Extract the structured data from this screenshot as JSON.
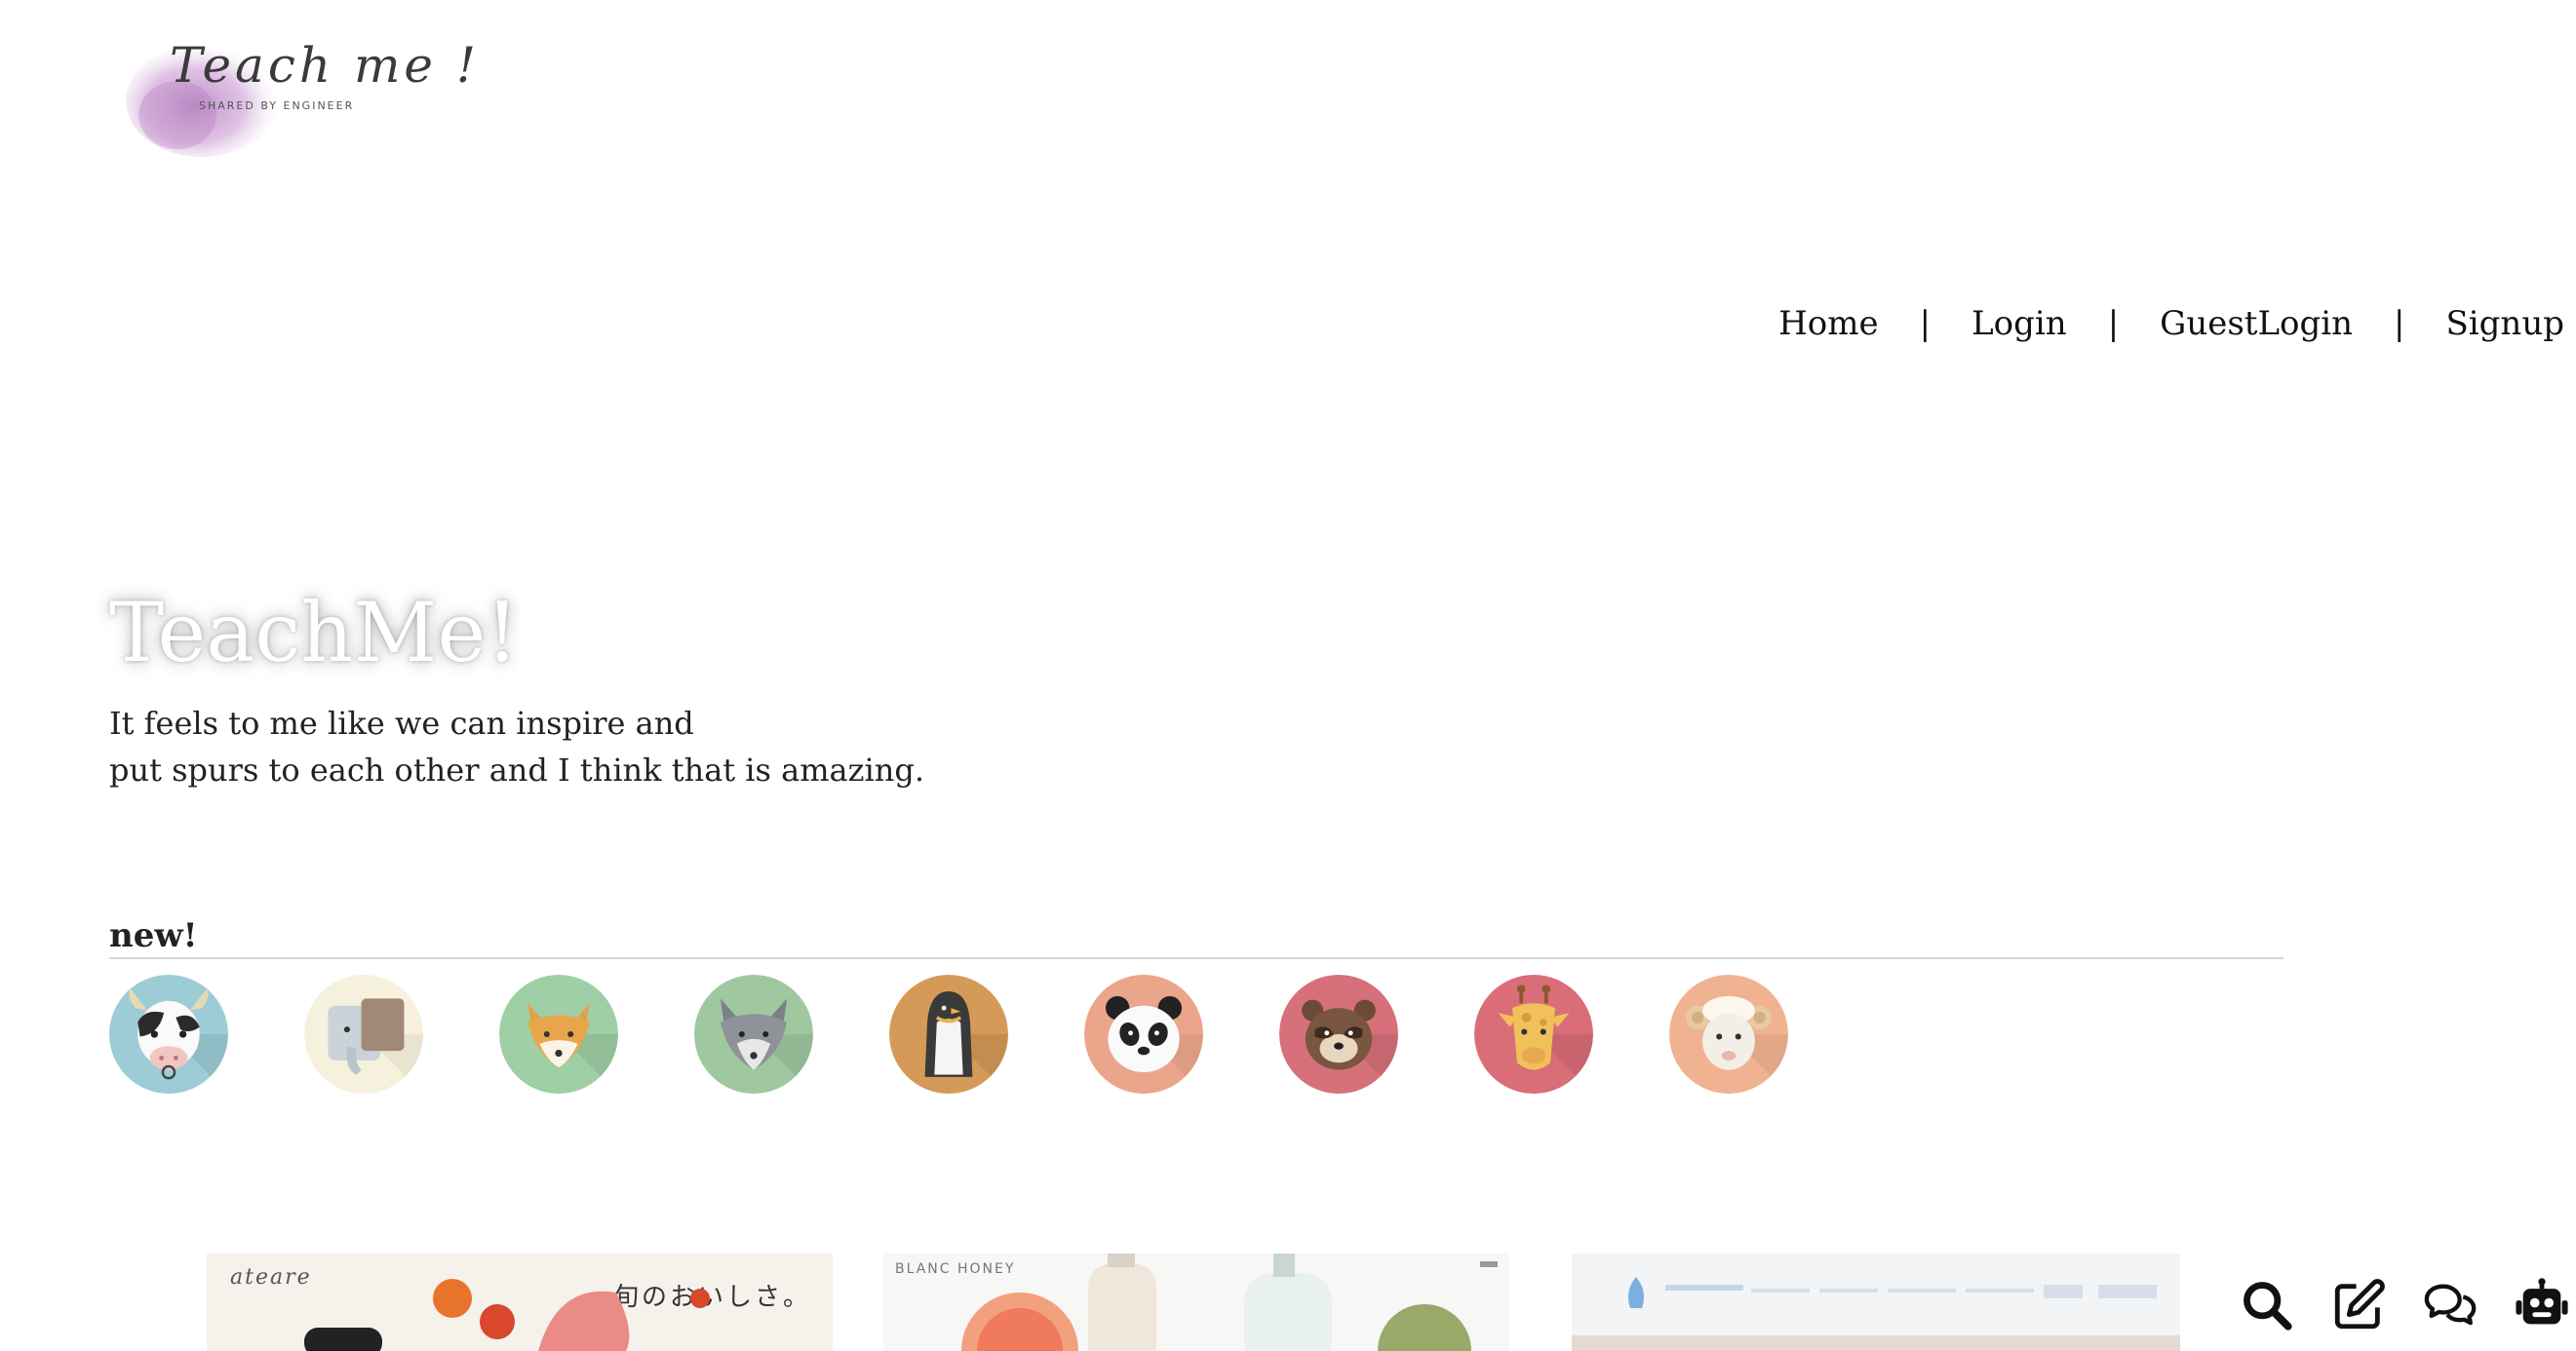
{
  "logo": {
    "script": "Teach me !",
    "tagline": "SHARED BY ENGINEER"
  },
  "nav": {
    "items": [
      {
        "label": "Home"
      },
      {
        "label": "Login"
      },
      {
        "label": "GuestLogin"
      },
      {
        "label": "Signup"
      }
    ],
    "separator": "|"
  },
  "hero": {
    "title": "TeachMe!",
    "line1": "It feels to me like we can inspire and",
    "line2": "put spurs to each other and I think that is amazing."
  },
  "new_section": {
    "label": "new!",
    "avatars": [
      {
        "icon": "cow-icon",
        "bg": "#9dccd6"
      },
      {
        "icon": "elephant-icon",
        "bg": "#f6f1dc"
      },
      {
        "icon": "fox-icon",
        "bg": "#9fcfa4"
      },
      {
        "icon": "wolf-icon",
        "bg": "#9fc8a0"
      },
      {
        "icon": "penguin-icon",
        "bg": "#d59a57"
      },
      {
        "icon": "panda-icon",
        "bg": "#eba58a"
      },
      {
        "icon": "bear-icon",
        "bg": "#d6707a"
      },
      {
        "icon": "giraffe-icon",
        "bg": "#d96d78"
      },
      {
        "icon": "sheep-icon",
        "bg": "#f0b391"
      }
    ]
  },
  "cards": [
    {
      "title": "ateare",
      "jp": "旬のおいしさ。"
    },
    {
      "title": "BLANC HONEY",
      "jp": ""
    },
    {
      "title": "",
      "jp": ""
    }
  ],
  "tools": [
    {
      "icon": "search-icon"
    },
    {
      "icon": "edit-icon"
    },
    {
      "icon": "chat-icon"
    },
    {
      "icon": "robot-icon"
    }
  ]
}
